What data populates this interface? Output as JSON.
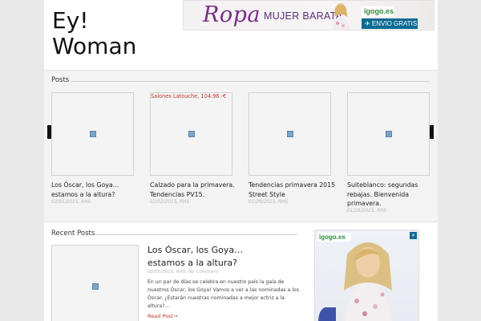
{
  "site": {
    "title_line1": "Ey!",
    "title_line2": "Woman"
  },
  "banner": {
    "headline": "Ropa",
    "subline": "MUJER BARATA",
    "logo": "ïgogo.es",
    "shipping": "✈ ENVIO GRATIS",
    "accent": "#7a2c86"
  },
  "posts": {
    "heading": "Posts",
    "prev_icon": "←",
    "next_icon": "→",
    "items": [
      {
        "title": "Los Óscar, los Goya… estamos a la altura?",
        "meta": "02/05/2015, RHS",
        "ad": ""
      },
      {
        "title": "Calzado para la primavera. Tendencias PV15.",
        "meta": "02/02/2015, RHS",
        "ad": "Salones Latouche, 104.96.-€"
      },
      {
        "title": "Tendencias primavera 2015 Street Style",
        "meta": "01/29/2015, RHS",
        "ad": ""
      },
      {
        "title": "Suiteblanco: segundas rebajas. Bienvenida primavera.",
        "meta": "01/28/2015, RHS",
        "ad": ""
      }
    ]
  },
  "recent": {
    "heading": "Recent Posts",
    "post": {
      "title": "Los Óscar, los Goya… estamos a la altura?",
      "meta": "02/05/2015, RHS, No Comment",
      "excerpt": "En un par de días se celebra en nuestro país la gala de nuestros Óscar, los Goya! Vamos a ver a las nominadas a los Óscar. ¿Estarán nuestras nominadas a mejor actriz a la altura?…",
      "read_more": "Read Post→"
    },
    "ad_logo": "ïgogo.es",
    "ad_close": "✕"
  }
}
